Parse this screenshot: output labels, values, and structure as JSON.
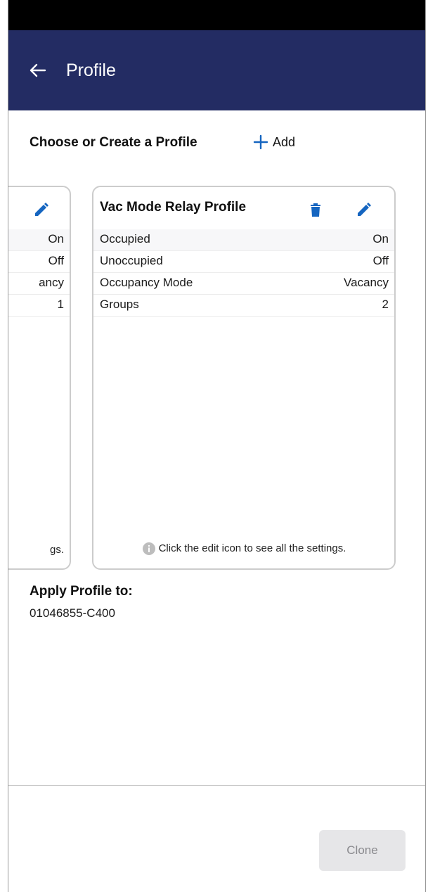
{
  "header": {
    "title": "Profile",
    "back_icon": "arrow-left-icon",
    "bg_color": "#232c63"
  },
  "section": {
    "title": "Choose or Create a Profile",
    "add_label": "Add",
    "add_icon": "plus-icon",
    "accent": "#1565c0"
  },
  "profiles": [
    {
      "name": "",
      "rows": [
        {
          "label": "",
          "value": "On"
        },
        {
          "label": "",
          "value": "Off"
        },
        {
          "label": "",
          "value": "ancy"
        },
        {
          "label": "",
          "value": "1"
        }
      ],
      "note": "gs."
    },
    {
      "name": "Vac Mode Relay Profile",
      "rows": [
        {
          "label": "Occupied",
          "value": "On"
        },
        {
          "label": "Unoccupied",
          "value": "Off"
        },
        {
          "label": "Occupancy Mode",
          "value": "Vacancy"
        },
        {
          "label": "Groups",
          "value": "2"
        }
      ],
      "note": "Click the edit icon to see all the settings."
    }
  ],
  "apply": {
    "heading": "Apply Profile to:",
    "target": "01046855-C400"
  },
  "footer": {
    "clone_label": "Clone"
  }
}
